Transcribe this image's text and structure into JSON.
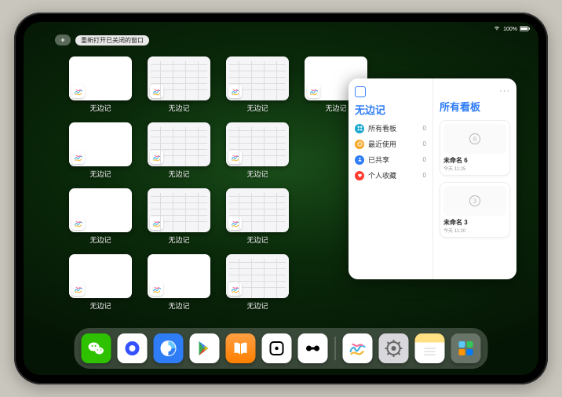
{
  "status": {
    "battery_text": "100%"
  },
  "top_bar": {
    "reopen_label": "重新打开已关闭的窗口"
  },
  "app_windows": {
    "label": "无边记",
    "items": [
      {
        "style": "blank"
      },
      {
        "style": "cal"
      },
      {
        "style": "cal"
      },
      {
        "style": "blank"
      },
      {
        "style": "blank"
      },
      {
        "style": "cal"
      },
      {
        "style": "cal"
      },
      {
        "style": "blank"
      },
      {
        "style": "cal"
      },
      {
        "style": "cal"
      },
      {
        "style": "blank"
      },
      {
        "style": "blank"
      },
      {
        "style": "cal"
      }
    ]
  },
  "detail": {
    "more": "···",
    "title_left": "无边记",
    "title_right": "所有看板",
    "nav": [
      {
        "icon": "grid",
        "color": "#1aa7d0",
        "label": "所有看板",
        "count": "0"
      },
      {
        "icon": "clock",
        "color": "#f5a623",
        "label": "最近使用",
        "count": "0"
      },
      {
        "icon": "share",
        "color": "#2f7df6",
        "label": "已共享",
        "count": "0"
      },
      {
        "icon": "heart",
        "color": "#ff3b30",
        "label": "个人收藏",
        "count": "0"
      }
    ],
    "boards": [
      {
        "digit": "6",
        "label": "未命名 6",
        "sub": "今天 11:25"
      },
      {
        "digit": "3",
        "label": "未命名 3",
        "sub": "今天 11:20"
      }
    ]
  },
  "dock": {
    "apps": [
      {
        "name": "wechat",
        "bg": "#2dc100"
      },
      {
        "name": "quark",
        "bg": "#ffffff"
      },
      {
        "name": "qqbrowser",
        "bg": "#2f7df6"
      },
      {
        "name": "gplay",
        "bg": "#ffffff"
      },
      {
        "name": "books",
        "bg": "linear-gradient(#ff9f43,#ff7f00)"
      },
      {
        "name": "dice",
        "bg": "#ffffff"
      },
      {
        "name": "connect",
        "bg": "#ffffff"
      }
    ],
    "recent": [
      {
        "name": "freeform",
        "bg": "#ffffff"
      },
      {
        "name": "settings",
        "bg": "#d8d8dc"
      },
      {
        "name": "notes",
        "bg": "linear-gradient(#ffe083 30%,#fff 30%)"
      },
      {
        "name": "library",
        "bg": "rgba(255,255,255,.25)"
      }
    ]
  }
}
